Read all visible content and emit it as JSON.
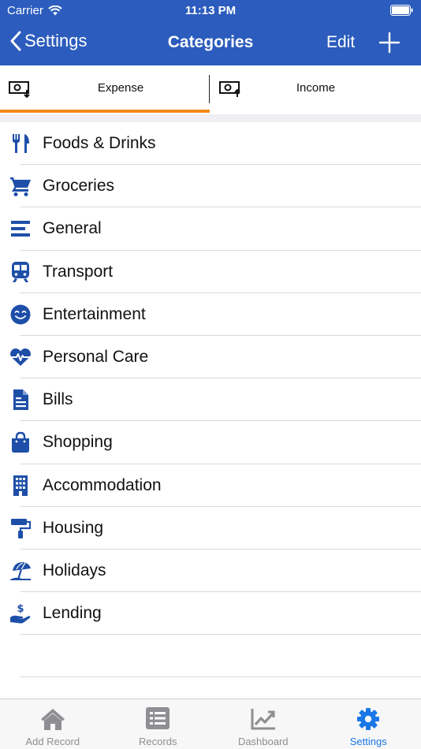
{
  "status_bar": {
    "carrier": "Carrier",
    "time": "11:13 PM"
  },
  "nav": {
    "back_label": "Settings",
    "title": "Categories",
    "edit_label": "Edit"
  },
  "segments": [
    {
      "label": "Expense",
      "selected": true
    },
    {
      "label": "Income",
      "selected": false
    }
  ],
  "colors": {
    "nav_bar": "#2c5cbd",
    "icon": "#1e4fa8",
    "selected_underline": "#f48a1c",
    "active_tab": "#1a78e6"
  },
  "categories": [
    {
      "label": "Foods & Drinks",
      "icon": "fork-knife-icon"
    },
    {
      "label": "Groceries",
      "icon": "shopping-cart-icon"
    },
    {
      "label": "General",
      "icon": "lines-icon"
    },
    {
      "label": "Transport",
      "icon": "train-icon"
    },
    {
      "label": "Entertainment",
      "icon": "smiley-icon"
    },
    {
      "label": "Personal Care",
      "icon": "heartbeat-icon"
    },
    {
      "label": "Bills",
      "icon": "document-icon"
    },
    {
      "label": "Shopping",
      "icon": "shopping-bag-icon"
    },
    {
      "label": "Accommodation",
      "icon": "building-icon"
    },
    {
      "label": "Housing",
      "icon": "paint-roller-icon"
    },
    {
      "label": "Holidays",
      "icon": "beach-umbrella-icon"
    },
    {
      "label": "Lending",
      "icon": "hand-dollar-icon"
    }
  ],
  "tabs": [
    {
      "label": "Add Record",
      "icon": "home-icon",
      "active": false
    },
    {
      "label": "Records",
      "icon": "list-icon",
      "active": false
    },
    {
      "label": "Dashboard",
      "icon": "chart-icon",
      "active": false
    },
    {
      "label": "Settings",
      "icon": "gear-icon",
      "active": true
    }
  ]
}
